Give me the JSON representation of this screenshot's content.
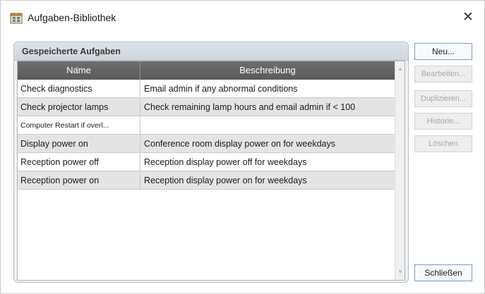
{
  "window": {
    "title": "Aufgaben-Bibliothek",
    "close_glyph": "✕",
    "icon": "task-library-icon"
  },
  "group": {
    "title": "Gespeicherte Aufgaben"
  },
  "table": {
    "columns": [
      "Name",
      "Beschreibung"
    ],
    "rows": [
      {
        "name": "Check diagnostics",
        "description": "Email admin if any abnormal conditions"
      },
      {
        "name": "Check projector lamps",
        "description": "Check remaining lamp hours and email admin if < 100"
      },
      {
        "name": "Computer Restart if overl...",
        "description": ""
      },
      {
        "name": "Display power on",
        "description": "Conference room display power on for weekdays"
      },
      {
        "name": "Reception power off",
        "description": "Reception display power off for weekdays"
      },
      {
        "name": "Reception power on",
        "description": "Reception display power on for weekdays"
      }
    ]
  },
  "buttons": {
    "new": "Neu...",
    "edit": "Bearbeiten...",
    "duplicate": "Duplizieren...",
    "history": "Historie...",
    "delete": "Löschen",
    "close": "Schließen"
  },
  "colors": {
    "header_bg": "#636363",
    "row_alt_bg": "#e4e4e4",
    "group_bg": "#eef1f4"
  }
}
